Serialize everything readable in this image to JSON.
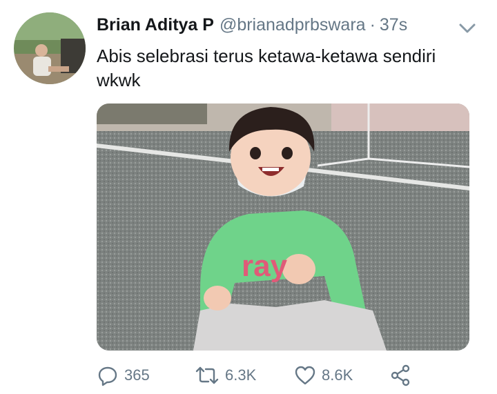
{
  "tweet": {
    "author": {
      "name": "Brian Aditya P",
      "handle": "@brianadprbswara",
      "avatar_icon": "profile-photo"
    },
    "separator": "·",
    "time": "37s",
    "text": "Abis selebrasi terus ketawa-ketawa sendiri wkwk",
    "media_icon": "photo-child-green-sweater",
    "media_sweater_text": "ray",
    "actions": {
      "reply": {
        "icon": "reply-bubble-icon",
        "count": "365"
      },
      "retweet": {
        "icon": "retweet-icon",
        "count": "6.3K"
      },
      "like": {
        "icon": "heart-icon",
        "count": "8.6K"
      },
      "share": {
        "icon": "share-icon"
      }
    },
    "menu_icon": "chevron-down-icon"
  },
  "colors": {
    "text_primary": "#14171a",
    "text_secondary": "#657786",
    "background": "#ffffff"
  }
}
